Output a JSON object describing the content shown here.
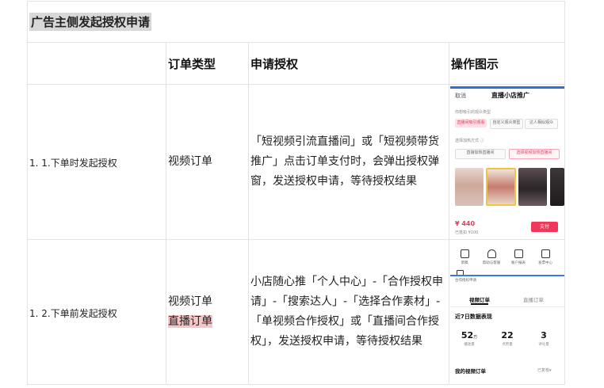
{
  "title": "广告主侧发起授权申请",
  "headers": [
    "",
    "订单类型",
    "申请授权",
    "操作图示"
  ],
  "rows": [
    {
      "label": "1. 1.下单时发起授权",
      "order_type": [
        "视频订单"
      ],
      "description": "「短视频引流直播间」或「短视频带货推广」点击订单支付时，会弹出授权弹窗，发送授权申请，等待授权结果"
    },
    {
      "label": "1. 2.下单前发起授权",
      "order_type": [
        "视频订单",
        "直播订单"
      ],
      "description": "小店随心推「个人中心」-「合作授权申请」-「搜索达人」-「选择合作素材」-「单视频合作授权」或「直播间合作授权」，发送授权申请，等待授权结果"
    }
  ],
  "colors": {
    "highlight": "#f6c6c6",
    "title_bg": "#d8d8d8",
    "accent_red": "#f0365c",
    "accent_blue": "#3b78e0"
  },
  "shot1": {
    "cancel": "取消",
    "heading": "直播小店推广",
    "line1": "你想吸引的观众类型",
    "chips1": [
      "直播间吸引观看",
      "自定义观众类型",
      "达人相似观众"
    ],
    "line2": "选择加热方式 ⓘ",
    "chips2": [
      "直接加热直播间",
      "选择视频加热直播间"
    ],
    "price": "¥ 440",
    "price_sub": "已抵扣 ¥100",
    "pay": "支付"
  },
  "shot2": {
    "icons": [
      {
        "name": "draft-icon",
        "label": "草稿"
      },
      {
        "name": "headset-icon",
        "label": "帮助与客服"
      },
      {
        "name": "account-icon",
        "label": "账户报表"
      },
      {
        "name": "message-icon",
        "label": "发票中心"
      }
    ],
    "gem_label": "合作授权申请",
    "tabs": [
      "视频订单",
      "直播订单"
    ],
    "section_title": "近7日数据表现",
    "stats": [
      {
        "value": "52",
        "unit": "万",
        "label": "播放量"
      },
      {
        "value": "22",
        "unit": "",
        "label": "点赞量"
      },
      {
        "value": "3",
        "unit": "",
        "label": "评论量"
      }
    ],
    "order_title": "我的视频订单",
    "order_more": "已复核"
  }
}
